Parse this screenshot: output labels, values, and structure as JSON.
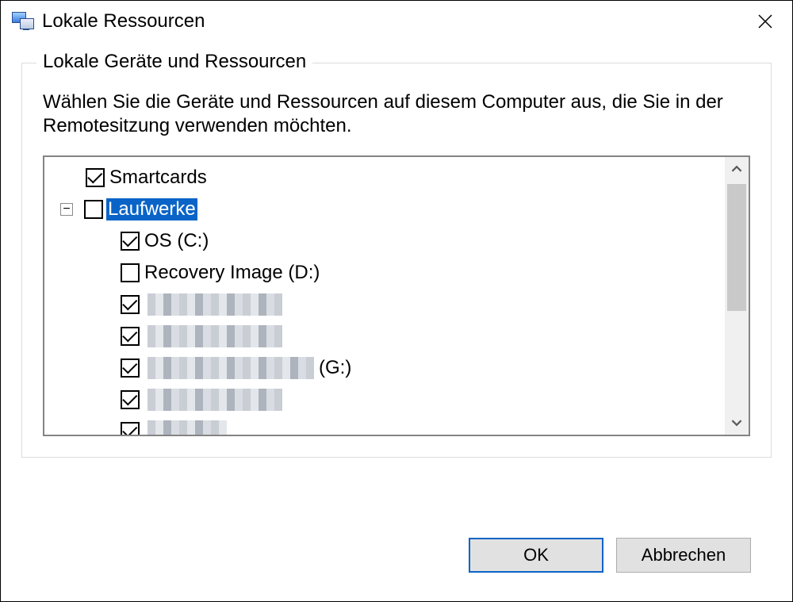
{
  "window": {
    "title": "Lokale Ressourcen"
  },
  "group": {
    "legend": "Lokale Geräte und Ressourcen",
    "description": "Wählen Sie die Geräte und Ressourcen auf diesem Computer aus, die Sie in der Remotesitzung verwenden möchten."
  },
  "tree": {
    "items": [
      {
        "kind": "leaf",
        "indent": 0,
        "checked": true,
        "label": "Smartcards"
      },
      {
        "kind": "parent",
        "indent": 1,
        "checked": false,
        "selected": true,
        "expanded": true,
        "label": "Laufwerke"
      },
      {
        "kind": "leaf",
        "indent": 2,
        "checked": true,
        "label": "OS (C:)"
      },
      {
        "kind": "leaf",
        "indent": 2,
        "checked": false,
        "label": "Recovery Image (D:)"
      },
      {
        "kind": "leaf",
        "indent": 2,
        "checked": true,
        "redacted": true,
        "redactedWidth": 170
      },
      {
        "kind": "leaf",
        "indent": 2,
        "checked": true,
        "redacted": true,
        "redactedWidth": 170
      },
      {
        "kind": "leaf",
        "indent": 2,
        "checked": true,
        "redacted": true,
        "redactedWidth": 210,
        "suffix": "(G:)"
      },
      {
        "kind": "leaf",
        "indent": 2,
        "checked": true,
        "redacted": true,
        "redactedWidth": 170
      },
      {
        "kind": "leaf",
        "indent": 2,
        "checked": true,
        "redacted": true,
        "redactedWidth": 100
      }
    ]
  },
  "buttons": {
    "ok": "OK",
    "cancel": "Abbrechen"
  }
}
